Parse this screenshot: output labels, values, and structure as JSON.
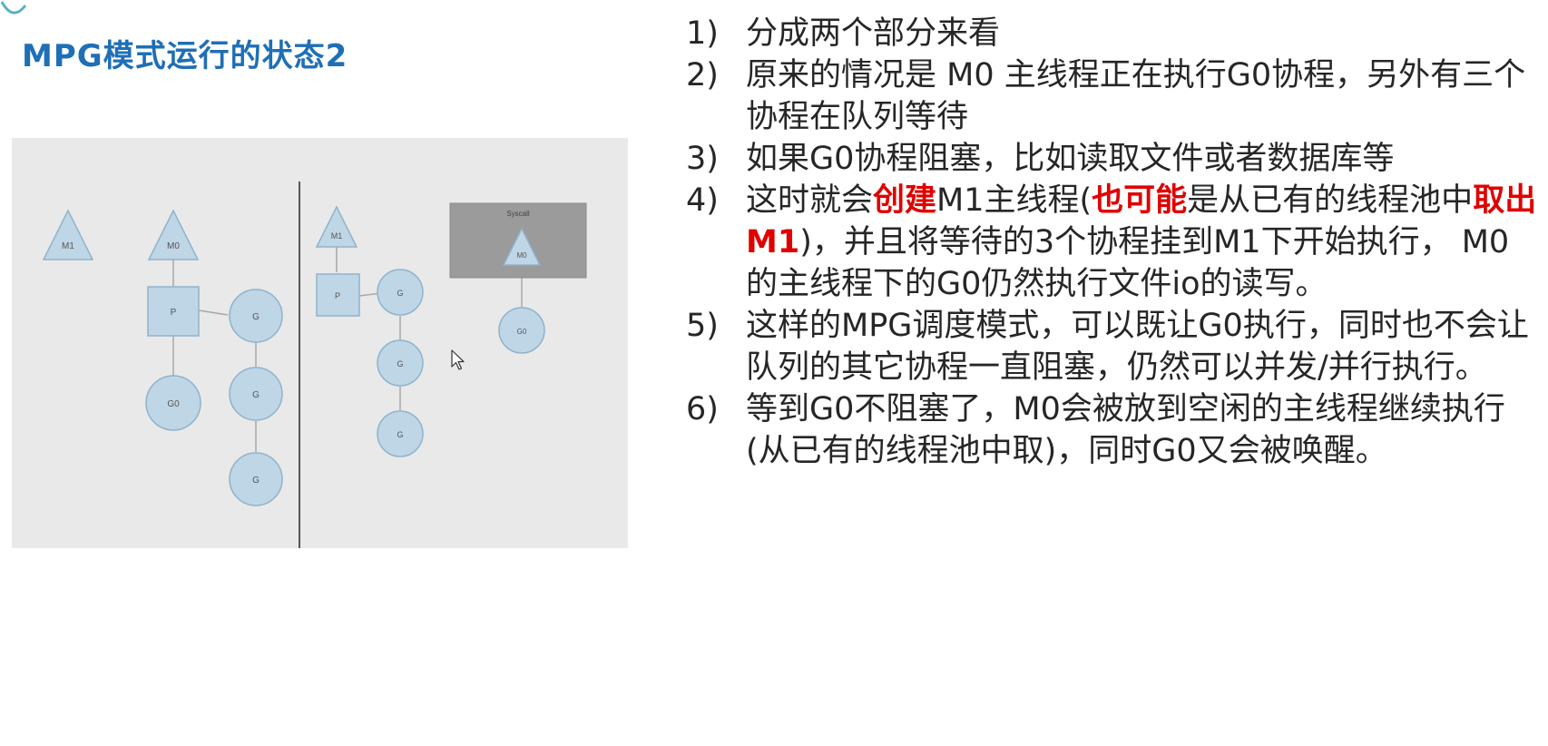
{
  "title": "MPG模式运行的状态2",
  "colors": {
    "title": "#1f6fb6",
    "highlight": "#e00000",
    "text": "#262626",
    "diagram_bg": "#e9e9e9",
    "node_fill": "#bfd6e6",
    "node_stroke": "#8fb3cc",
    "syscall_bg": "#9b9b9b"
  },
  "diagram": {
    "left_labels": {
      "m1": "M1",
      "m0": "M0",
      "p": "P",
      "g0": "G0",
      "g1": "G",
      "g2": "G",
      "g3": "G"
    },
    "right_labels": {
      "m1": "M1",
      "p": "P",
      "g1": "G",
      "g2": "G",
      "g3": "G",
      "syscall": "Syscall",
      "m0": "M0",
      "g0": "G0"
    }
  },
  "items": [
    {
      "num": "1)",
      "segments": [
        {
          "text": "分成两个部分来看",
          "hl": false
        }
      ]
    },
    {
      "num": "2)",
      "segments": [
        {
          "text": "原来的情况是 M0 主线程正在执行G0协程，另外有三个协程在队列等待",
          "hl": false
        }
      ]
    },
    {
      "num": "3)",
      "segments": [
        {
          "text": "如果G0协程阻塞，比如读取文件或者数据库等",
          "hl": false
        }
      ]
    },
    {
      "num": "4)",
      "segments": [
        {
          "text": "这时就会",
          "hl": false
        },
        {
          "text": "创建",
          "hl": true
        },
        {
          "text": "M1主线程(",
          "hl": false
        },
        {
          "text": "也可能",
          "hl": true
        },
        {
          "text": "是从已有的线程池中",
          "hl": false
        },
        {
          "text": "取出M1",
          "hl": true
        },
        {
          "text": ")，并且将等待的3个协程挂到M1下开始执行，  M0的主线程下的G0仍然执行文件io的读写。",
          "hl": false
        }
      ]
    },
    {
      "num": "5)",
      "segments": [
        {
          "text": "这样的MPG调度模式，可以既让G0执行，同时也不会让队列的其它协程一直阻塞，仍然可以并发/并行执行。",
          "hl": false
        }
      ]
    },
    {
      "num": "6)",
      "segments": [
        {
          "text": "等到G0不阻塞了，M0会被放到空闲的主线程继续执行(从已有的线程池中取)，同时G0又会被唤醒。",
          "hl": false
        }
      ]
    }
  ]
}
